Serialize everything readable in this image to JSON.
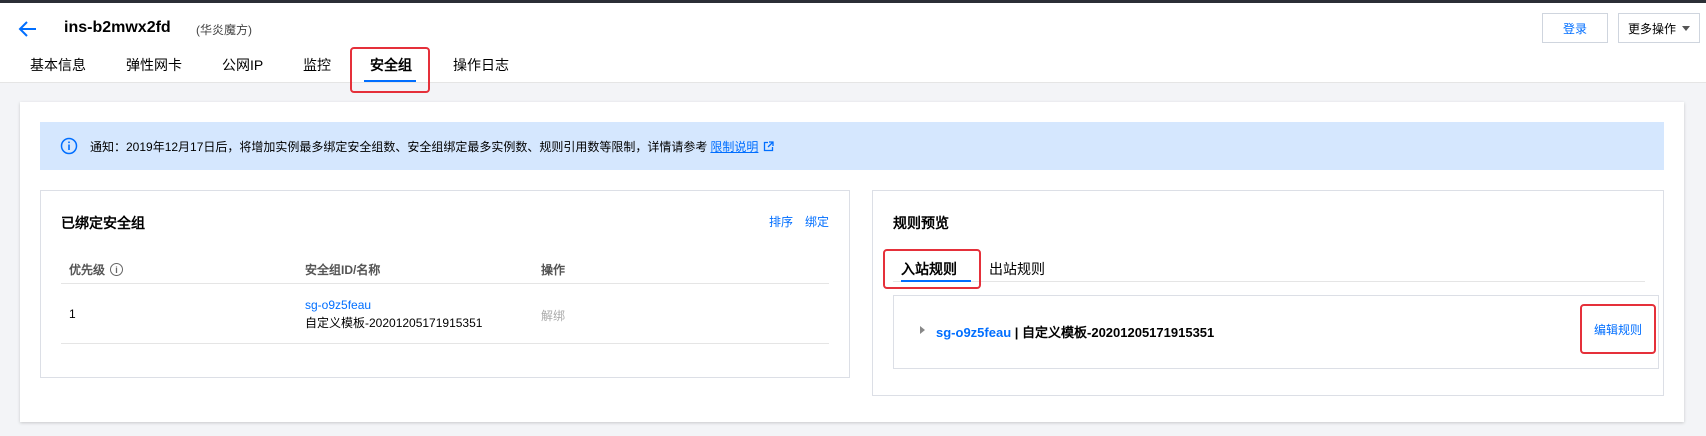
{
  "header": {
    "instance_id": "ins-b2mwx2fd",
    "instance_region": "(华炎魔方)",
    "login_label": "登录",
    "more_label": "更多操作"
  },
  "tabs": [
    {
      "label": "基本信息"
    },
    {
      "label": "弹性网卡"
    },
    {
      "label": "公网IP"
    },
    {
      "label": "监控"
    },
    {
      "label": "安全组"
    },
    {
      "label": "操作日志"
    }
  ],
  "active_tab": "安全组",
  "notice": {
    "text": "通知：2019年12月17日后，将增加实例最多绑定安全组数、安全组绑定最多实例数、规则引用数等限制，详情请参考",
    "link": "限制说明"
  },
  "bound_groups": {
    "title": "已绑定安全组",
    "actions": [
      "排序",
      "绑定"
    ],
    "columns": [
      "优先级",
      "安全组ID/名称",
      "操作"
    ],
    "rows": [
      {
        "priority": "1",
        "sg_id": "sg-o9z5feau",
        "sg_name": "自定义模板-20201205171915351",
        "action": "解绑"
      }
    ]
  },
  "rules_preview": {
    "title": "规则预览",
    "tabs": [
      "入站规则",
      "出站规则"
    ],
    "active_tab": "入站规则",
    "group_id": "sg-o9z5feau",
    "separator": " | ",
    "group_name": "自定义模板-20201205171915351",
    "edit_label": "编辑规则"
  },
  "colors": {
    "accent": "#006eff",
    "highlight": "#e5303a",
    "notice_bg": "#d5e7fe"
  }
}
